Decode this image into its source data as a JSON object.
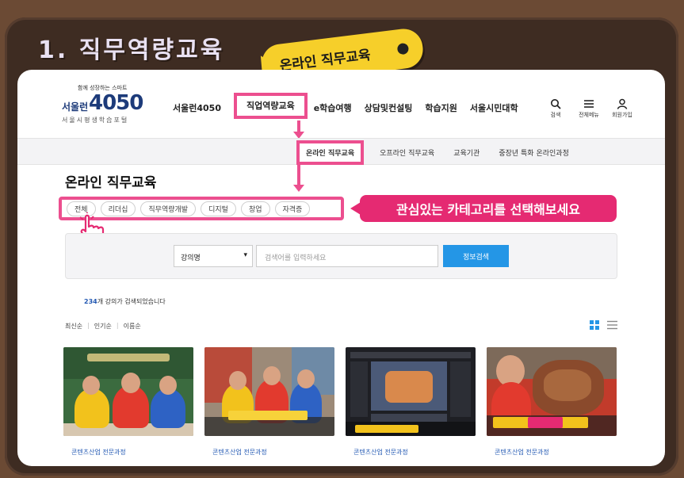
{
  "slide": {
    "title": "1. 직무역량교육",
    "bubble_label": "온라인 직무교육"
  },
  "header": {
    "logo": {
      "tagline": "함께 성장하는 스마트",
      "brand": "서울런",
      "number": "4050",
      "subtitle": "서울시평생학습포털"
    },
    "nav": [
      {
        "label": "서울런4050"
      },
      {
        "label": "직업역량교육"
      },
      {
        "label": "e학습여행"
      },
      {
        "label": "상담및컨설팅"
      },
      {
        "label": "학습지원"
      },
      {
        "label": "서울시민대학"
      }
    ],
    "util": [
      {
        "label": "검색",
        "icon": "search-icon"
      },
      {
        "label": "전체메뉴",
        "icon": "menu-icon"
      },
      {
        "label": "회원가입",
        "icon": "user-icon"
      }
    ]
  },
  "subnav": [
    {
      "label": "온라인 직무교육"
    },
    {
      "label": "오프라인 직무교육"
    },
    {
      "label": "교육기관"
    },
    {
      "label": "중장년 특화 온라인과정"
    }
  ],
  "page_title": "온라인 직무교육",
  "categories": [
    "전체",
    "리더십",
    "직무역량개발",
    "디지털",
    "창업",
    "자격증"
  ],
  "callout": "관심있는 카테고리를 선택해보세요",
  "search": {
    "select_value": "강의명",
    "placeholder": "검색어를 입력하세요",
    "button": "정보검색"
  },
  "results": {
    "count": "234",
    "suffix": "개 강의가 검색되었습니다"
  },
  "sort": [
    "최신순",
    "인기순",
    "이름순"
  ],
  "cards": [
    {
      "category": "콘텐츠산업 전문과정"
    },
    {
      "category": "콘텐츠산업 전문과정"
    },
    {
      "category": "콘텐츠산업 전문과정"
    },
    {
      "category": "콘텐츠산업 전문과정"
    }
  ],
  "colors": {
    "highlight": "#ec4f8f",
    "callout": "#e52a72",
    "bubble": "#f6cf2a",
    "button": "#2496e6",
    "board": "#3e2c22"
  }
}
